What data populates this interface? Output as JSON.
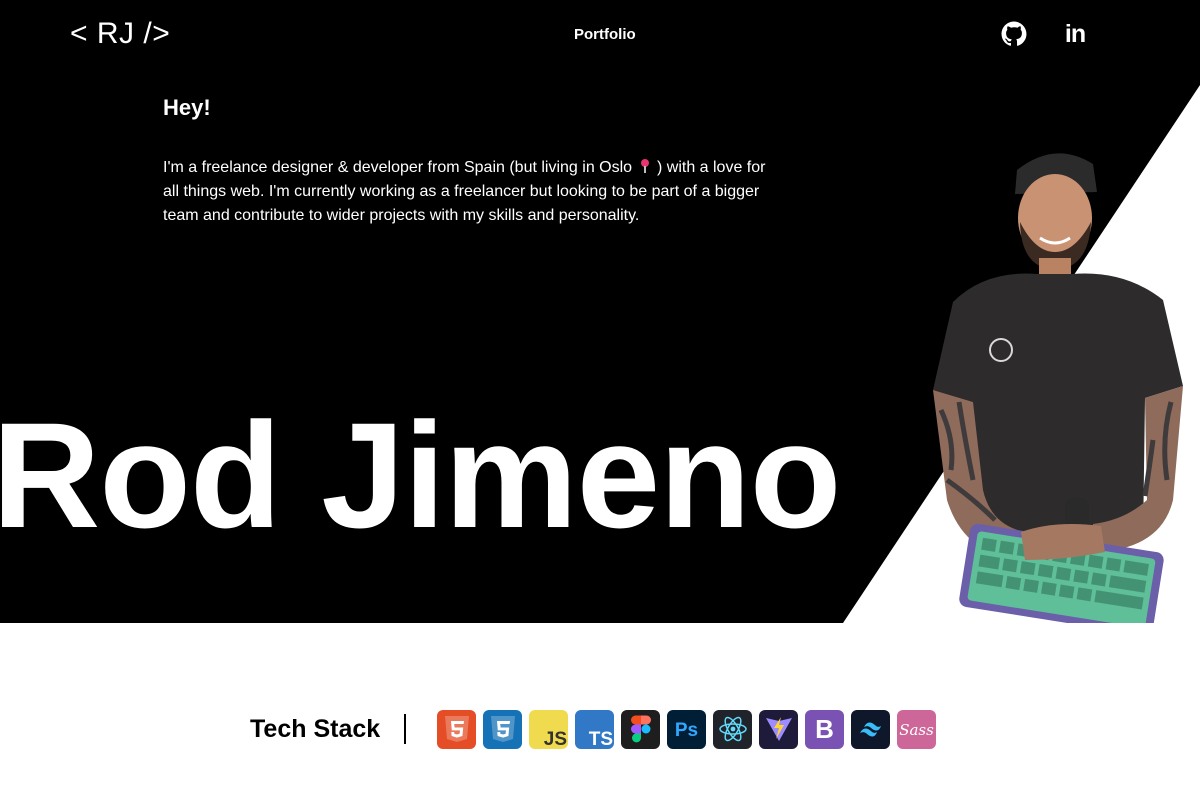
{
  "header": {
    "logo": "< RJ />",
    "nav_link": "Portfolio",
    "social": [
      {
        "name": "github",
        "icon": "github-icon"
      },
      {
        "name": "linkedin",
        "icon": "linkedin-icon",
        "glyph": "in"
      }
    ]
  },
  "hero": {
    "greeting": "Hey!",
    "intro_part1": "I'm a freelance designer & developer from Spain (but living in Oslo",
    "intro_part2": ") with a love for all things web. I'm currently working as a freelancer but looking to be part of a bigger team and contribute to wider projects with my skills and personality.",
    "name": "Rod Jimeno",
    "portrait_icon": "portrait-photo"
  },
  "tech_stack": {
    "title": "Tech Stack",
    "icons": [
      {
        "name": "HTML5",
        "icon": "html5-icon",
        "color": "#e44d26"
      },
      {
        "name": "CSS3",
        "icon": "css3-icon",
        "color": "#1572b6"
      },
      {
        "name": "JS",
        "icon": "javascript-icon",
        "color": "#f0db4f"
      },
      {
        "name": "TS",
        "icon": "typescript-icon",
        "color": "#3178c6"
      },
      {
        "name": "Figma",
        "icon": "figma-icon",
        "color": "#1e1e1e"
      },
      {
        "name": "Ps",
        "icon": "photoshop-icon",
        "color": "#001e36"
      },
      {
        "name": "React",
        "icon": "react-icon",
        "color": "#20232a"
      },
      {
        "name": "Vite",
        "icon": "vite-icon",
        "color": "#1e1b3a"
      },
      {
        "name": "B",
        "icon": "bootstrap-icon",
        "color": "#7952b3"
      },
      {
        "name": "Tailwind",
        "icon": "tailwind-icon",
        "color": "#0f172a"
      },
      {
        "name": "Sass",
        "icon": "sass-icon",
        "color": "#cd6799"
      }
    ]
  },
  "colors": {
    "hero_bg": "#000000",
    "page_bg": "#ffffff",
    "text_light": "#ffffff",
    "text_dark": "#000000"
  }
}
